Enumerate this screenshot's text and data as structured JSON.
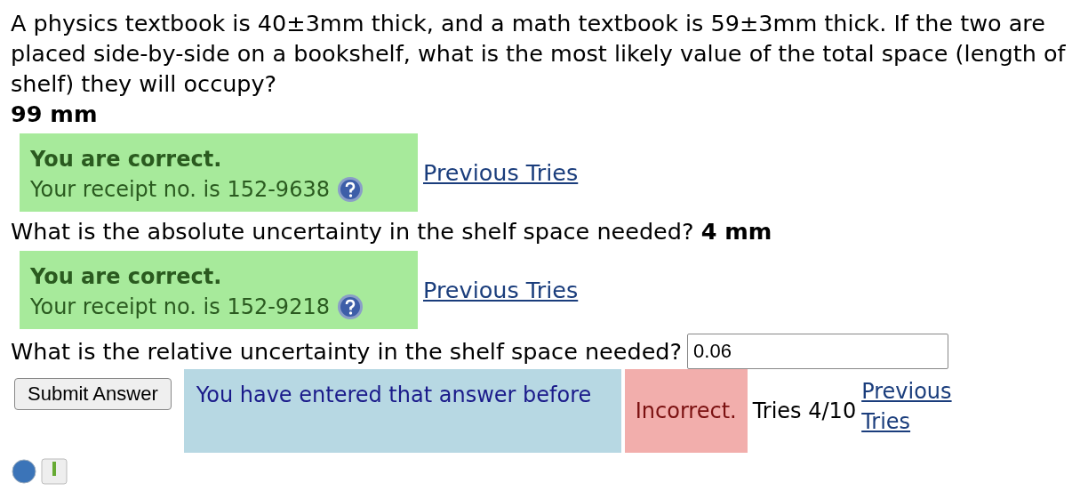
{
  "parts": [
    {
      "kind": "block_answer",
      "prompt": "A physics textbook is 40±3mm thick, and a math textbook is 59±3mm thick. If the two are placed side-by-side on a bookshelf, what is the most likely value of the total space (length of shelf) they will occupy?",
      "answer": "99 mm",
      "feedback": {
        "correct": true,
        "title": "You are correct.",
        "receipt": "Your receipt no. is 152-9638"
      },
      "link": "Previous Tries"
    },
    {
      "kind": "inline_answer",
      "prompt": "What is the absolute uncertainty in the shelf space needed?",
      "answer": "4 mm",
      "feedback": {
        "correct": true,
        "title": "You are correct.",
        "receipt": "Your receipt no. is 152-9218"
      },
      "link": "Previous Tries"
    },
    {
      "kind": "entry",
      "prompt": "What is the relative uncertainty in the shelf space needed?",
      "input": {
        "value": "0.06"
      },
      "submit_button": "Submit Answer",
      "message": "You have entered that answer before",
      "feedback": {
        "correct": false,
        "title": "Incorrect."
      },
      "tries": "Tries 4/10",
      "link": "Previous Tries"
    }
  ]
}
